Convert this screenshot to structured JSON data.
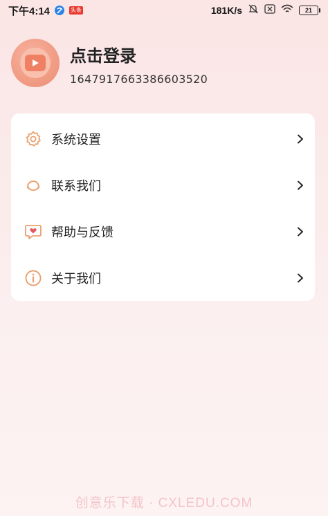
{
  "status_bar": {
    "time": "下午4:14",
    "badge_text": "头条",
    "net_speed": "181K/s",
    "battery": "21"
  },
  "profile": {
    "title": "点击登录",
    "user_id": "1647917663386603520"
  },
  "menu": {
    "items": [
      {
        "label": "系统设置",
        "icon": "gear-icon"
      },
      {
        "label": "联系我们",
        "icon": "headset-icon"
      },
      {
        "label": "帮助与反馈",
        "icon": "heart-chat-icon"
      },
      {
        "label": "关于我们",
        "icon": "info-icon"
      }
    ]
  },
  "watermark": "创意乐下载 · CXLEDU.COM",
  "colors": {
    "accent_orange": "#e9a16e",
    "heart_red": "#e45a5a",
    "avatar": "#f19c84",
    "background_top": "#fbe5e5"
  }
}
